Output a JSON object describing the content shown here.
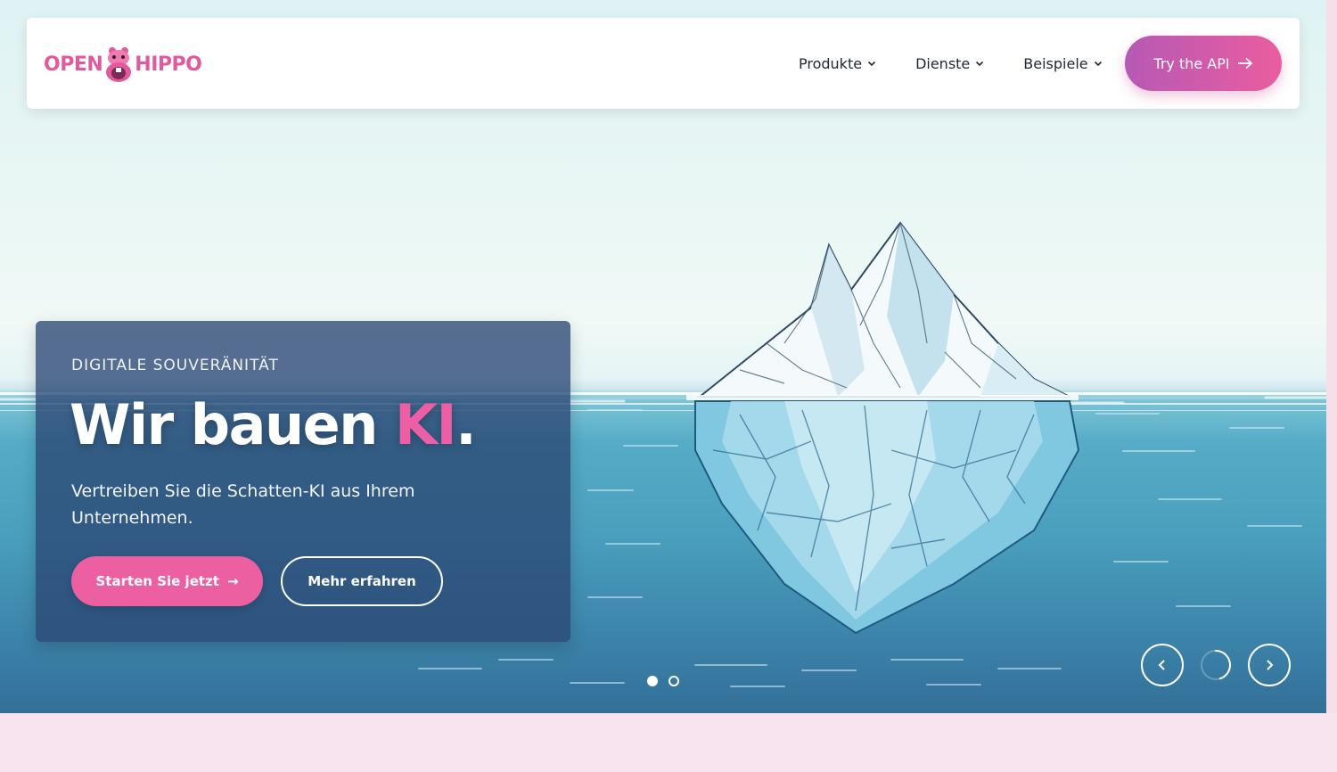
{
  "brand": {
    "logo_left": "OPEN",
    "logo_right": "HIPPO",
    "accent_color": "#e35a9c",
    "icon": "hippo-mascot-icon"
  },
  "nav": {
    "items": [
      {
        "label": "Produkte",
        "icon": "chevron-down-icon"
      },
      {
        "label": "Dienste",
        "icon": "chevron-down-icon"
      },
      {
        "label": "Beispiele",
        "icon": "chevron-down-icon"
      }
    ],
    "cta_label": "Try the API",
    "cta_icon": "arrow-right-icon",
    "cta_gradient": [
      "#b659b5",
      "#ea5d9f"
    ]
  },
  "hero": {
    "eyebrow": "DIGITALE SOUVERÄNITÄT",
    "headline_main": "Wir bauen ",
    "headline_accent": "KI",
    "headline_end": ".",
    "subline": "Vertreiben Sie die Schatten-KI aus Ihrem Unternehmen.",
    "primary_button": "Starten Sie jetzt",
    "primary_arrow": "→",
    "secondary_button": "Mehr erfahren",
    "primary_color": "#ec5fa0",
    "card_color": "#2a4673"
  },
  "slider": {
    "slide_count": 2,
    "active_slide": 1,
    "prev_icon": "chevron-left-icon",
    "next_icon": "chevron-right-icon",
    "autoplay_progress": 0.45
  }
}
